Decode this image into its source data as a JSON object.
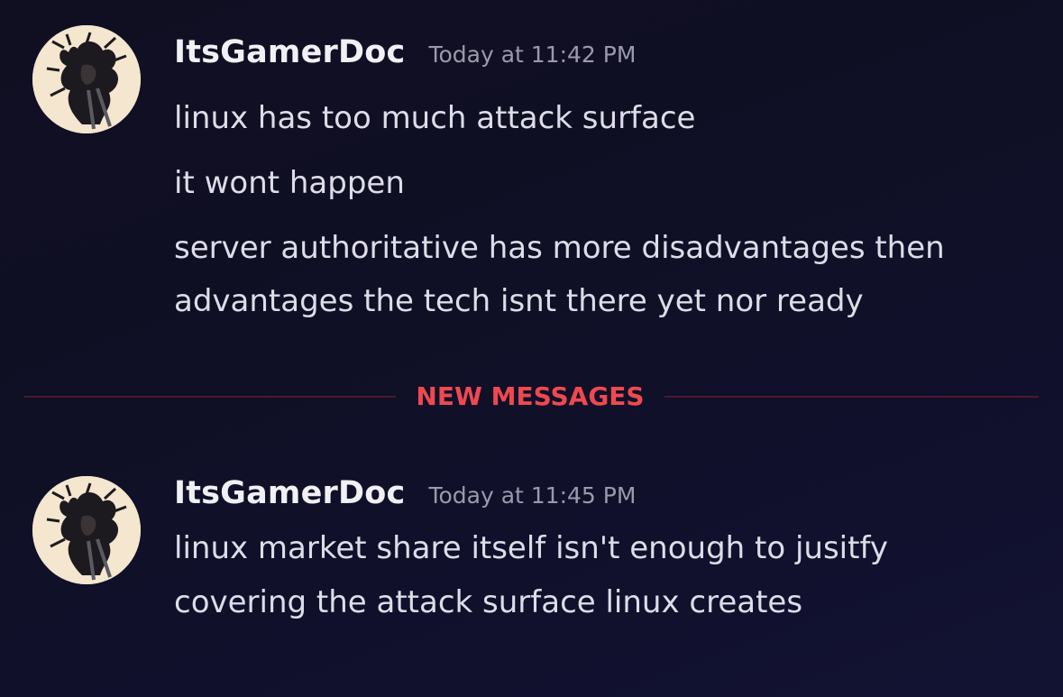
{
  "messages": [
    {
      "username": "ItsGamerDoc",
      "timestamp": "Today at 11:42 PM",
      "lines": [
        "linux has too much attack surface",
        "it wont happen",
        "server authoritative has more disadvantages then",
        "advantages the tech isnt there yet nor ready"
      ]
    },
    {
      "username": "ItsGamerDoc",
      "timestamp": "Today at 11:45 PM",
      "lines": [
        "linux market share itself isn't enough to jusitfy",
        "covering the attack surface linux creates"
      ]
    }
  ],
  "divider": {
    "label": "NEW MESSAGES",
    "color": "#ee4950"
  },
  "colors": {
    "background": "#0f0f25",
    "username": "#f0f0f5",
    "timestamp": "#9a9aab",
    "text": "#dddde8",
    "avatar_bg": "#f4e6cf"
  },
  "icons": {
    "avatar": "sketched-character-avatar"
  }
}
